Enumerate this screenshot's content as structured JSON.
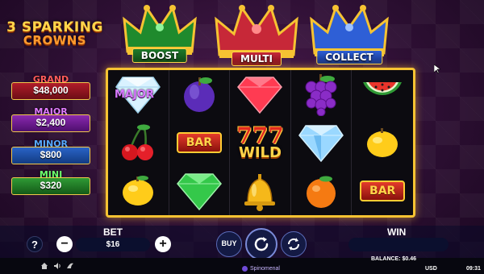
{
  "game": {
    "logo_line1": "3 SPARKING",
    "logo_line2": "CROWNS"
  },
  "crowns": [
    {
      "label": "BOOST",
      "color": "#1f8a2d"
    },
    {
      "label": "MULTI",
      "color": "#c72838"
    },
    {
      "label": "COLLECT",
      "color": "#2e5fd6"
    }
  ],
  "jackpots": {
    "grand": {
      "title": "GRAND",
      "value": "$48,000"
    },
    "major": {
      "title": "MAJOR",
      "value": "$2,400"
    },
    "minor": {
      "title": "MINOR",
      "value": "$800"
    },
    "mini": {
      "title": "MINI",
      "value": "$320"
    }
  },
  "reels": {
    "rows": [
      [
        "diamond-major",
        "plum",
        "red-gem",
        "grapes",
        "watermelon"
      ],
      [
        "cherries",
        "bar",
        "777-wild",
        "blue-diamond",
        "lemon"
      ],
      [
        "lemon",
        "green-gem",
        "bell",
        "orange",
        "bar"
      ]
    ],
    "major_label": "MAJOR",
    "bar_label": "BAR",
    "wild_label": "WILD",
    "sevens_label": "777"
  },
  "controls": {
    "help_label": "?",
    "bet_title": "BET",
    "bet_value": "$16",
    "minus_label": "−",
    "plus_label": "+",
    "buy_label": "BUY",
    "win_title": "WIN",
    "win_value": ""
  },
  "status": {
    "balance": "BALANCE: $0.46",
    "currency": "USD",
    "clock": "09:31",
    "brand": "Spinomenal"
  }
}
